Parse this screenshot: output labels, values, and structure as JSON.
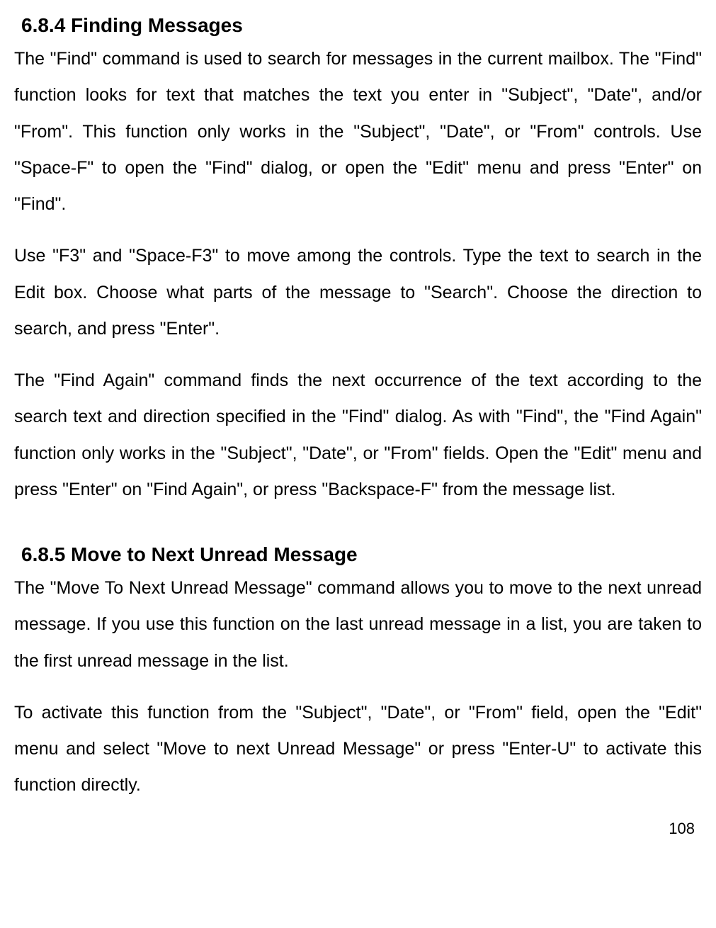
{
  "section1": {
    "heading": "6.8.4 Finding Messages",
    "para1": "The \"Find\" command is used to search for messages in the current mailbox. The \"Find\" function looks for text that matches the text you enter in \"Subject\", \"Date\", and/or \"From\". This function only works in the \"Subject\", \"Date\", or \"From\" controls. Use \"Space-F\" to open the \"Find\" dialog, or open the \"Edit\" menu and press \"Enter\" on \"Find\".",
    "para2": "Use \"F3\" and \"Space-F3\" to move among the controls. Type the text to search in the Edit box. Choose what parts of the message to \"Search\". Choose the direction to search, and press \"Enter\".",
    "para3": "The \"Find Again\" command finds the next occurrence of the text according to the search text and direction specified in the \"Find\" dialog. As with \"Find\", the \"Find Again\" function only works in the \"Subject\", \"Date\", or \"From\" fields. Open the \"Edit\" menu and press \"Enter\" on \"Find Again\", or press \"Backspace-F\" from the message list."
  },
  "section2": {
    "heading": "6.8.5 Move to Next Unread Message",
    "para1": "The \"Move To Next Unread Message\" command allows you to move to the next unread message. If you use this function on the last unread message in a list, you are taken to the first unread message in the list.",
    "para2": "To activate this function from the \"Subject\", \"Date\", or \"From\" field, open the \"Edit\" menu and select \"Move to next Unread Message\" or press \"Enter-U\" to activate this function directly."
  },
  "pageNumber": "108"
}
